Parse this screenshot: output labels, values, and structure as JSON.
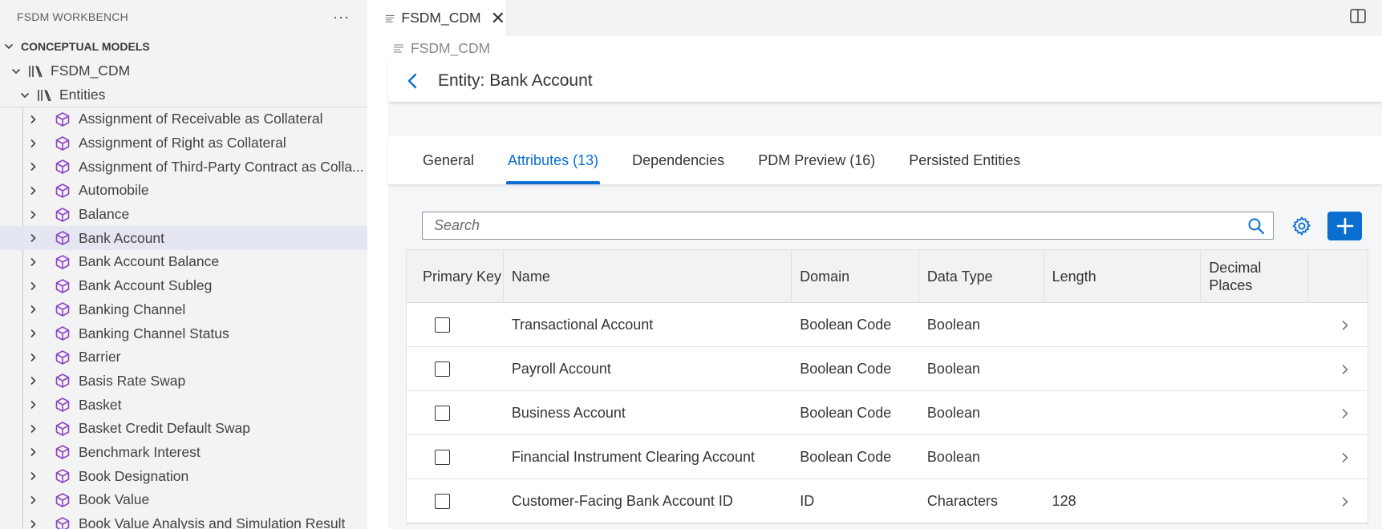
{
  "sidebar": {
    "title": "FSDM WORKBENCH",
    "more_label": "···",
    "section": "CONCEPTUAL MODELS",
    "model": "FSDM_CDM",
    "folder": "Entities",
    "entities": [
      {
        "label": "Assignment of Receivable as Collateral"
      },
      {
        "label": "Assignment of Right as Collateral"
      },
      {
        "label": "Assignment of Third-Party Contract as Colla..."
      },
      {
        "label": "Automobile"
      },
      {
        "label": "Balance"
      },
      {
        "label": "Bank Account",
        "selected": true
      },
      {
        "label": "Bank Account Balance"
      },
      {
        "label": "Bank Account Subleg"
      },
      {
        "label": "Banking Channel"
      },
      {
        "label": "Banking Channel Status"
      },
      {
        "label": "Barrier"
      },
      {
        "label": "Basis Rate Swap"
      },
      {
        "label": "Basket"
      },
      {
        "label": "Basket Credit Default Swap"
      },
      {
        "label": "Benchmark Interest"
      },
      {
        "label": "Book Designation"
      },
      {
        "label": "Book Value"
      },
      {
        "label": "Book Value Analysis and Simulation Result"
      }
    ]
  },
  "editor": {
    "tab_label": "FSDM_CDM",
    "breadcrumb": "FSDM_CDM",
    "object_title": "Entity: Bank Account",
    "tabs": [
      {
        "label": "General"
      },
      {
        "label": "Attributes (13)",
        "active": true
      },
      {
        "label": "Dependencies"
      },
      {
        "label": "PDM Preview (16)"
      },
      {
        "label": "Persisted Entities"
      }
    ],
    "search_placeholder": "Search",
    "table": {
      "headers": {
        "primary_key": "Primary Key",
        "name": "Name",
        "domain": "Domain",
        "data_type": "Data Type",
        "length": "Length",
        "decimal_places_1": "Decimal",
        "decimal_places_2": "Places"
      },
      "rows": [
        {
          "primary_key": false,
          "name": "Transactional Account",
          "domain": "Boolean Code",
          "data_type": "Boolean",
          "length": "",
          "decimal_places": ""
        },
        {
          "primary_key": false,
          "name": "Payroll Account",
          "domain": "Boolean Code",
          "data_type": "Boolean",
          "length": "",
          "decimal_places": ""
        },
        {
          "primary_key": false,
          "name": "Business Account",
          "domain": "Boolean Code",
          "data_type": "Boolean",
          "length": "",
          "decimal_places": ""
        },
        {
          "primary_key": false,
          "name": "Financial Instrument Clearing Account",
          "domain": "Boolean Code",
          "data_type": "Boolean",
          "length": "",
          "decimal_places": ""
        },
        {
          "primary_key": false,
          "name": "Customer-Facing Bank Account ID",
          "domain": "ID",
          "data_type": "Characters",
          "length": "128",
          "decimal_places": ""
        }
      ]
    }
  },
  "colors": {
    "accent": "#0a6ed1",
    "sidebar_bg": "#f3f3f3",
    "selected_row": "#e4e6f1",
    "entity_icon": "#8e44c7"
  },
  "icons": {
    "more": "more-icon",
    "chevron": "chevron-right-icon",
    "library": "library-icon",
    "entity": "cube-icon",
    "document": "document-icon",
    "close": "close-icon",
    "split": "split-editor-icon",
    "back": "back-arrow-icon",
    "search": "search-icon",
    "settings": "gear-icon",
    "add": "plus-icon",
    "navigate": "chevron-right-icon"
  }
}
